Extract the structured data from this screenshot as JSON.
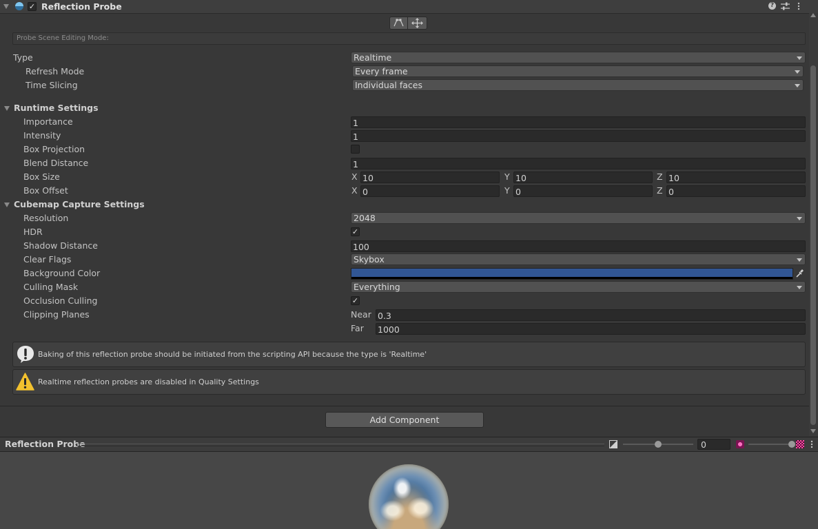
{
  "header": {
    "title": "Reflection Probe",
    "enabled": true,
    "icons": [
      "help-icon",
      "preset-icon",
      "more-icon"
    ]
  },
  "edit_mode": {
    "label": "Probe Scene Editing Mode:"
  },
  "type_rows": [
    {
      "label": "Type",
      "value": "Realtime"
    },
    {
      "label": "Refresh Mode",
      "value": "Every frame"
    },
    {
      "label": "Time Slicing",
      "value": "Individual faces"
    }
  ],
  "runtime": {
    "title": "Runtime Settings",
    "importance_label": "Importance",
    "importance": "1",
    "intensity_label": "Intensity",
    "intensity": "1",
    "box_projection_label": "Box Projection",
    "box_projection": false,
    "blend_distance_label": "Blend Distance",
    "blend_distance": "1",
    "box_size_label": "Box Size",
    "box_size": {
      "x": "10",
      "y": "10",
      "z": "10"
    },
    "box_offset_label": "Box Offset",
    "box_offset": {
      "x": "0",
      "y": "0",
      "z": "0"
    },
    "axis_x": "X",
    "axis_y": "Y",
    "axis_z": "Z"
  },
  "cubemap": {
    "title": "Cubemap Capture Settings",
    "resolution_label": "Resolution",
    "resolution": "2048",
    "hdr_label": "HDR",
    "hdr": true,
    "shadow_distance_label": "Shadow Distance",
    "shadow_distance": "100",
    "clear_flags_label": "Clear Flags",
    "clear_flags": "Skybox",
    "background_color_label": "Background Color",
    "background_color": "#315694",
    "culling_mask_label": "Culling Mask",
    "culling_mask": "Everything",
    "occlusion_culling_label": "Occlusion Culling",
    "occlusion_culling": true,
    "clipping_planes_label": "Clipping Planes",
    "near_label": "Near",
    "near": "0.3",
    "far_label": "Far",
    "far": "1000"
  },
  "help_boxes": [
    {
      "kind": "info",
      "text": "Baking of this reflection probe should be initiated from the scripting API because the type is 'Realtime'"
    },
    {
      "kind": "warning",
      "text": "Realtime reflection probes are disabled in Quality Settings"
    }
  ],
  "add_component": {
    "label": "Add Component"
  },
  "preview": {
    "title": "Reflection Probe",
    "exposure": "0",
    "exposure_slider": 0.5,
    "mip_slider": 1.0
  }
}
